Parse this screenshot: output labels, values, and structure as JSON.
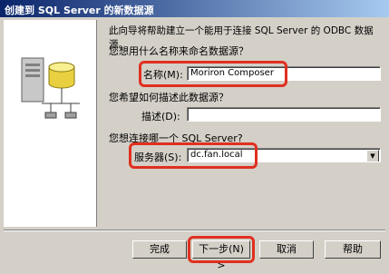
{
  "window": {
    "title": "创建到 SQL Server 的新数据源"
  },
  "intro": "此向导将帮助建立一个能用于连接 SQL Server 的 ODBC 数据源。",
  "name_question": "您想用什么名称来命名数据源？",
  "name_label": "名称(M):",
  "name_value": "Moriron Composer",
  "desc_question": "您希望如何描述此数据源？",
  "desc_label": "描述(D):",
  "desc_value": "",
  "server_question": "您想连接哪一个 SQL Server?",
  "server_label": "服务器(S):",
  "server_value": "dc.fan.local",
  "buttons": {
    "finish": "完成",
    "next": "下一步(N) >",
    "cancel": "取消",
    "help": "帮助"
  },
  "colors": {
    "highlight": "#e03020",
    "titlebar": "#0a246a"
  }
}
